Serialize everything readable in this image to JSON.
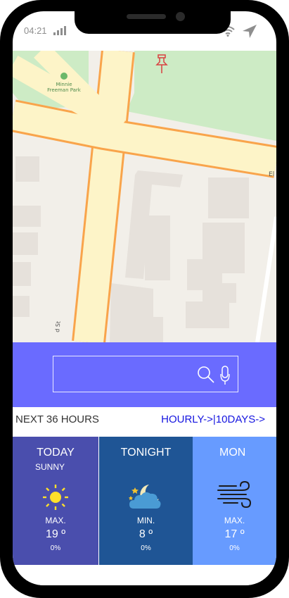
{
  "status_bar": {
    "time": "04:21"
  },
  "search": {
    "placeholder": ""
  },
  "next_section": {
    "label": "NEXT 36 HOURS",
    "link_label": "HOURLY->|10DAYS->"
  },
  "forecast": [
    {
      "title": "TODAY",
      "condition": "SUNNY",
      "icon": "sun-icon",
      "kind": "MAX.",
      "temp": "19 º",
      "precip": "0%",
      "color": "#4a4ead"
    },
    {
      "title": "TONIGHT",
      "condition": "",
      "icon": "moon-cloud-icon",
      "kind": "MIN.",
      "temp": "8 º",
      "precip": "0%",
      "color": "#1f5595"
    },
    {
      "title": "MON",
      "condition": "",
      "icon": "wind-icon",
      "kind": "MAX.",
      "temp": "17 º",
      "precip": "0%",
      "color": "#679bff"
    }
  ],
  "map": {
    "park_label_line1": "Minnie",
    "park_label_line2": "Freeman Park",
    "street_label": "El",
    "street_label_2": "d St"
  },
  "colors": {
    "search_panel": "#6a6bff",
    "link": "#1515e0"
  }
}
